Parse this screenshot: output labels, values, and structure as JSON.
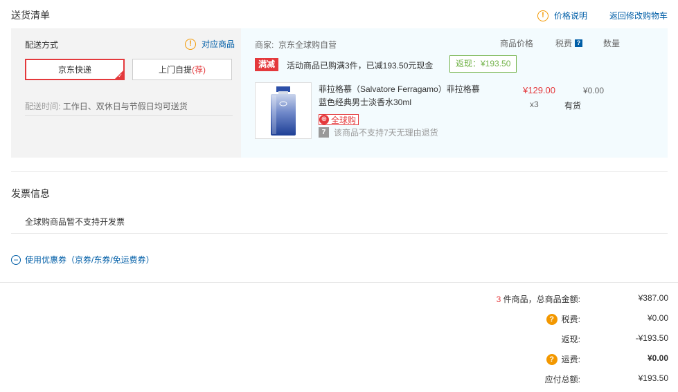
{
  "header": {
    "title": "送货清单",
    "price_explain": "价格说明",
    "back_to_cart": "返回修改购物车"
  },
  "shipping": {
    "label": "配送方式",
    "corr_goods": "对应商品",
    "option_jd": "京东快递",
    "option_self": "上门自提",
    "option_self_tag": "(荐)",
    "time_label": "配送时间:",
    "time_value": "工作日、双休日与节假日均可送货"
  },
  "order": {
    "merchant_label": "商家:",
    "merchant_name": "京东全球购自营",
    "col_price": "商品价格",
    "col_tax": "税费",
    "col_qty": "数量",
    "promo_tag": "满减",
    "promo_text": "活动商品已购满3件，已减193.50元现金",
    "rebate": "返现：¥193.50",
    "product": {
      "name_line1": "菲拉格慕（Salvatore Ferragamo）菲拉格慕",
      "name_line2": "蓝色经典男士淡香水30ml",
      "price": "¥129.00",
      "tax": "¥0.00",
      "qty": "x3",
      "stock": "有货",
      "badge": "全球购",
      "no_return": "该商品不支持7天无理由退货"
    }
  },
  "invoice": {
    "title": "发票信息",
    "text": "全球购商品暂不支持开发票"
  },
  "coupon": {
    "label": "使用优惠券（京券/东券/免运费券）"
  },
  "summary": {
    "count": "3",
    "count_label": "件商品，总商品金额:",
    "total": "¥387.00",
    "tax_label": "税费:",
    "tax": "¥0.00",
    "rebate_label": "返现:",
    "rebate": "-¥193.50",
    "freight_label": "运费:",
    "freight": "¥0.00",
    "payable_label": "应付总额:",
    "payable": "¥193.50"
  },
  "colors": {
    "accent_red": "#e4393c",
    "link_blue": "#005ea7",
    "rebate_green": "#71b247",
    "warn_orange": "#f39800"
  }
}
